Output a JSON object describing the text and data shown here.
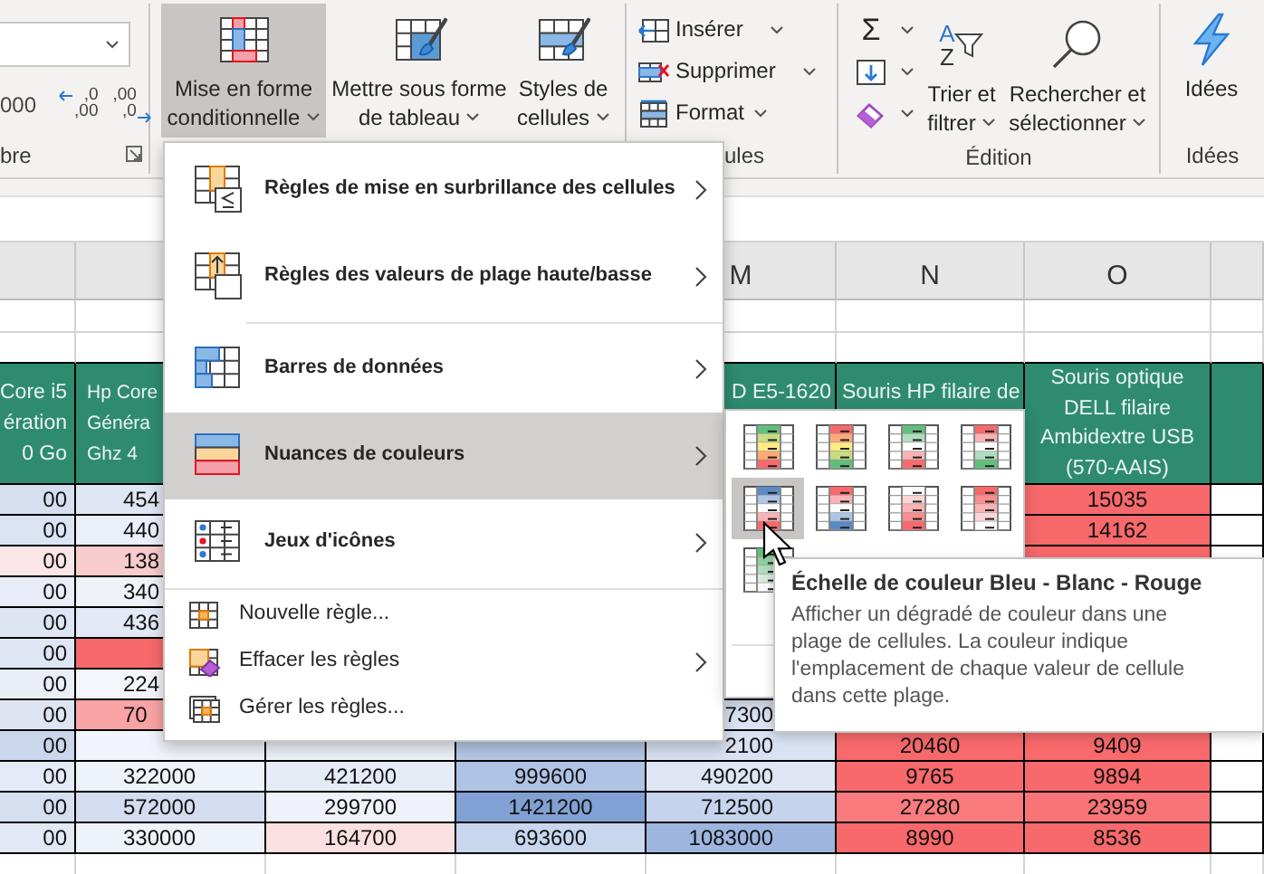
{
  "ribbon": {
    "number_group": {
      "label": "bre",
      "thousands_button": "000",
      "decimal_buttons": [
        {
          "kind": "increase",
          "top": ",0",
          "bottom": ",00"
        },
        {
          "kind": "decrease",
          "top": ",00",
          "bottom": ",0"
        }
      ]
    },
    "style_buttons": [
      {
        "kind": "conditional",
        "lines": [
          "Mise en forme",
          "conditionnelle"
        ],
        "pressed": true
      },
      {
        "kind": "table",
        "lines": [
          "Mettre sous forme",
          "de tableau"
        ],
        "pressed": false
      },
      {
        "kind": "cellstyles",
        "lines": [
          "Styles de",
          "cellules"
        ],
        "pressed": false
      }
    ],
    "cells_group": {
      "label": "ules",
      "buttons": [
        {
          "kind": "insert",
          "label": "Insérer"
        },
        {
          "kind": "delete",
          "label": "Supprimer"
        },
        {
          "kind": "format",
          "label": "Format"
        }
      ]
    },
    "editing_group": {
      "label": "Édition",
      "small_buttons": [
        {
          "kind": "sum",
          "glyph": "Σ"
        },
        {
          "kind": "fill"
        },
        {
          "kind": "clear"
        }
      ],
      "sort_button": {
        "letters": [
          "A",
          "Z"
        ],
        "lines": [
          "Trier et",
          "filtrer"
        ]
      },
      "find_button": {
        "lines": [
          "Rechercher et",
          "sélectionner"
        ]
      }
    },
    "ideas_group": {
      "label": "Idées",
      "button": "Idées"
    }
  },
  "sheet": {
    "column_letters": [
      "M",
      "N",
      "O"
    ],
    "header_row": {
      "column_1": "Core i5\nération\n0 Go",
      "column_2": "Hp Core\nGénéra\nGhz 4",
      "m": "D E5-1620",
      "n": "Souris HP filaire de",
      "o": "Souris optique\nDELL filaire\nAmbidextre USB\n(570-AAIS)"
    },
    "rows": [
      {
        "column_1": {
          "text": "00",
          "color": "#d5dff0"
        },
        "column_2": {
          "text": "454",
          "color": "#dfe7f4"
        },
        "o": {
          "text": "15035",
          "color": "#f8696b"
        }
      },
      {
        "column_1": {
          "text": "00",
          "color": "#dbe4f2"
        },
        "column_2": {
          "text": "440",
          "color": "#eaeff8"
        },
        "o": {
          "text": "14162",
          "color": "#f8696b"
        }
      },
      {
        "column_1": {
          "text": "00",
          "color": "#fbe6e7"
        },
        "column_2": {
          "text": "138",
          "color": "#f8cbcc"
        },
        "o": {
          "color": "#f8696b"
        }
      },
      {
        "column_1": {
          "text": "00",
          "color": "#e8edf7"
        },
        "column_2": {
          "text": "340",
          "color": "#eef2f9"
        }
      },
      {
        "column_1": {
          "text": "00",
          "color": "#dde5f3"
        },
        "column_2": {
          "text": "436",
          "color": "#e3eaf5"
        }
      },
      {
        "column_1": {
          "text": "00",
          "color": "#dfe6f3"
        },
        "column_2": {
          "color": "#f8696b"
        }
      },
      {
        "column_1": {
          "text": "00",
          "color": "#e9eef7"
        },
        "column_2": {
          "text": "224",
          "color": "#f4f6fb"
        }
      },
      {
        "column_1": {
          "text": "00",
          "color": "#dde5f2"
        },
        "column_2": {
          "text": "70",
          "color": "#f9a3a4"
        },
        "m": {
          "text": "7300",
          "color": "#dbe4f3"
        }
      },
      {
        "column_1": {
          "text": "00",
          "color": "#c9d6ec"
        },
        "column_2": {
          "color": "#f1f4fa"
        },
        "column_3": {
          "color": "#eef2f9"
        },
        "column_4": {
          "color": "#b7c9e8"
        },
        "m": {
          "text": "2100",
          "color": "#d9e2f2"
        },
        "n": {
          "text": "20460",
          "color": "#f8696b"
        },
        "o": {
          "text": "9409",
          "color": "#f8696b"
        }
      },
      {
        "column_1": {
          "text": "00",
          "color": "#e4eaf6"
        },
        "column_2": {
          "text": "322000",
          "color": "#eef2f9"
        },
        "column_3": {
          "text": "421200",
          "color": "#e6ecf6"
        },
        "column_4": {
          "text": "999600",
          "color": "#afc3e5"
        },
        "m": {
          "text": "490200",
          "color": "#dee6f4"
        },
        "n": {
          "text": "9765",
          "color": "#f8696b"
        },
        "o": {
          "text": "9894",
          "color": "#f8696b"
        }
      },
      {
        "column_1": {
          "text": "00",
          "color": "#d6dff0"
        },
        "column_2": {
          "text": "572000",
          "color": "#d3ddef"
        },
        "column_3": {
          "text": "299700",
          "color": "#eff3f9"
        },
        "column_4": {
          "text": "1421200",
          "color": "#81a1d4"
        },
        "m": {
          "text": "712500",
          "color": "#c5d4ec"
        },
        "n": {
          "text": "27280",
          "color": "#f97b7d"
        },
        "o": {
          "text": "23959",
          "color": "#f97476"
        }
      },
      {
        "column_1": {
          "text": "00",
          "color": "#e2e9f5"
        },
        "column_2": {
          "text": "330000",
          "color": "#eef2f9"
        },
        "column_3": {
          "text": "164700",
          "color": "#fbe0e1"
        },
        "column_4": {
          "text": "693600",
          "color": "#c8d6ee"
        },
        "m": {
          "text": "1083000",
          "color": "#9eb6df"
        },
        "n": {
          "text": "8990",
          "color": "#f8696b"
        },
        "o": {
          "text": "8536",
          "color": "#f8696b"
        }
      }
    ]
  },
  "menu": {
    "sections": [
      {
        "kind": "large",
        "items": [
          {
            "kind": "highlight",
            "label": "Règles de mise en surbrillance des cellules",
            "submenu": true,
            "selected": false
          },
          {
            "kind": "topbottom",
            "label": "Règles des valeurs de plage haute/basse",
            "submenu": true,
            "selected": false
          }
        ]
      },
      {
        "kind": "large",
        "items": [
          {
            "kind": "databars",
            "label": "Barres de données",
            "submenu": true,
            "selected": false
          },
          {
            "kind": "colorscales",
            "label": "Nuances de couleurs",
            "submenu": true,
            "selected": true
          },
          {
            "kind": "iconsets",
            "label": "Jeux d'icônes",
            "submenu": true,
            "selected": false
          }
        ]
      },
      {
        "kind": "small",
        "items": [
          {
            "kind": "newrule",
            "label": "Nouvelle règle...",
            "submenu": false,
            "selected": false
          },
          {
            "kind": "clearrules",
            "label": "Effacer les règles",
            "submenu": true,
            "selected": false
          },
          {
            "kind": "manage",
            "label": "Gérer les règles...",
            "submenu": false,
            "selected": false
          }
        ]
      }
    ]
  },
  "color_scale_menu": {
    "items": [
      {
        "stops": [
          {
            "color": "#63be7b"
          },
          {
            "color": "#c9dc81"
          },
          {
            "color": "#ffeb84"
          },
          {
            "color": "#fbaa77"
          },
          {
            "color": "#f8696b"
          }
        ],
        "selected": false
      },
      {
        "stops": [
          {
            "color": "#f8696b"
          },
          {
            "color": "#fbaa77"
          },
          {
            "color": "#ffeb84"
          },
          {
            "color": "#c9dc81"
          },
          {
            "color": "#63be7b"
          }
        ],
        "selected": false
      },
      {
        "stops": [
          {
            "color": "#63be7b"
          },
          {
            "color": "#b1dcbe"
          },
          {
            "color": "#fcfcff"
          },
          {
            "color": "#f9b3b5"
          },
          {
            "color": "#f8696b"
          }
        ],
        "selected": false
      },
      {
        "stops": [
          {
            "color": "#f8696b"
          },
          {
            "color": "#f9b3b5"
          },
          {
            "color": "#fcfcff"
          },
          {
            "color": "#b1dcbe"
          },
          {
            "color": "#63be7b"
          }
        ],
        "selected": false
      },
      {
        "stops": [
          {
            "color": "#5a8ac6"
          },
          {
            "color": "#adc5e3"
          },
          {
            "color": "#fcfcff"
          },
          {
            "color": "#f9b3b5"
          },
          {
            "color": "#f8696b"
          }
        ],
        "selected": true
      },
      {
        "stops": [
          {
            "color": "#f8696b"
          },
          {
            "color": "#f9b3b5"
          },
          {
            "color": "#fcfcff"
          },
          {
            "color": "#adc5e3"
          },
          {
            "color": "#5a8ac6"
          }
        ],
        "selected": false
      },
      {
        "stops": [
          {
            "color": "#fcfcff"
          },
          {
            "color": "#fcd6d7"
          },
          {
            "color": "#fab1b3"
          },
          {
            "color": "#f98d8f"
          },
          {
            "color": "#f8696b"
          }
        ],
        "selected": false
      },
      {
        "stops": [
          {
            "color": "#f8696b"
          },
          {
            "color": "#f98d8f"
          },
          {
            "color": "#fab1b3"
          },
          {
            "color": "#fcd6d7"
          },
          {
            "color": "#fcfcff"
          }
        ],
        "selected": false
      },
      {
        "stops": [
          {
            "color": "#63be7b"
          },
          {
            "color": "#8ccf9c"
          },
          {
            "color": "#b1dcbe"
          },
          {
            "color": "#d6ecde"
          },
          {
            "color": "#fcfcff"
          }
        ],
        "selected": false
      }
    ]
  },
  "tooltip": {
    "title": "Échelle de couleur Bleu - Blanc - Rouge",
    "text": "Afficher un dégradé de couleur dans une plage de cellules. La couleur indique l'emplacement de chaque valeur de cellule dans cette plage."
  }
}
